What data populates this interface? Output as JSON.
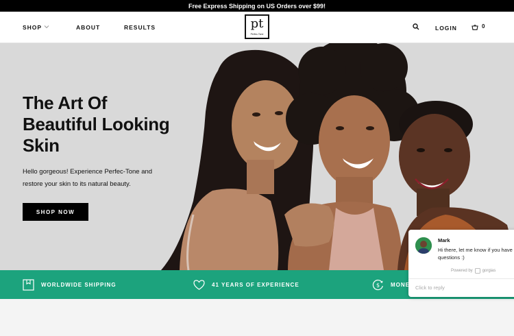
{
  "announcement": "Free Express Shipping on US Orders over $99!",
  "nav": {
    "shop": "SHOP",
    "about": "ABOUT",
    "results": "RESULTS",
    "login": "LOGIN",
    "cart_count": "0",
    "logo_text": "pt",
    "logo_subtext": "Perfec-Tone"
  },
  "hero": {
    "title": "The Art Of Beautiful Looking Skin",
    "subtitle": "Hello gorgeous! Experience Perfec-Tone and restore your skin to its natural beauty.",
    "cta": "SHOP NOW"
  },
  "benefits": [
    {
      "label": "WORLDWIDE SHIPPING",
      "icon": "box-icon"
    },
    {
      "label": "41 YEARS OF EXPERIENCE",
      "icon": "heart-icon"
    },
    {
      "label": "MONE",
      "icon": "money-icon"
    }
  ],
  "chat": {
    "agent_name": "Mark",
    "message": "Hi there, let me know if you have questions :)",
    "powered_by": "Powered by",
    "brand": "gorgias",
    "reply_placeholder": "Click to reply"
  },
  "colors": {
    "accent": "#1ca37d",
    "hero_bg": "#d9d9d9",
    "announcement_bg": "#000000"
  }
}
